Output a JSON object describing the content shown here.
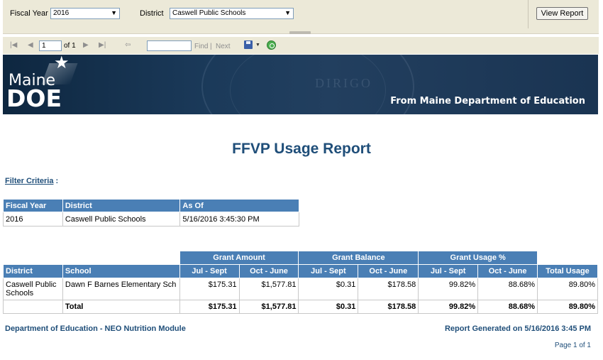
{
  "params": {
    "fiscal_year_label": "Fiscal Year",
    "fiscal_year_value": "2016",
    "district_label": "District",
    "district_value": "Caswell Public Schools",
    "view_report_label": "View Report"
  },
  "toolbar": {
    "page_value": "1",
    "of_pages": "of 1",
    "find_label": "Find",
    "separator": "|",
    "next_label": "Next"
  },
  "banner": {
    "logo_maine": "Maine",
    "logo_doe": "DOE",
    "seal_text": "DIRIGO",
    "tagline": "From Maine Department of Education"
  },
  "report": {
    "title": "FFVP Usage Report",
    "filter_criteria_label": "Filter Criteria",
    "filter_criteria_suffix": " :"
  },
  "filter_table": {
    "headers": [
      "Fiscal Year",
      "District",
      "As Of"
    ],
    "row": [
      "2016",
      "Caswell Public Schools",
      "5/16/2016 3:45:30 PM"
    ]
  },
  "usage_table": {
    "group_headers": [
      "Grant Amount",
      "Grant Balance",
      "Grant Usage %"
    ],
    "headers": [
      "District",
      "School",
      "Jul - Sept",
      "Oct - June",
      "Jul - Sept",
      "Oct - June",
      "Jul - Sept",
      "Oct - June",
      "Total Usage"
    ],
    "row": [
      "Caswell Public Schools",
      "Dawn F Barnes Elementary Sch",
      "$175.31",
      "$1,577.81",
      "$0.31",
      "$178.58",
      "99.82%",
      "88.68%",
      "89.80%"
    ],
    "total": [
      "",
      "Total",
      "$175.31",
      "$1,577.81",
      "$0.31",
      "$178.58",
      "99.82%",
      "88.68%",
      "89.80%"
    ]
  },
  "footer": {
    "left": "Department of Education - NEO Nutrition Module",
    "right": "Report Generated on 5/16/2016 3:45 PM",
    "page": "Page 1 of 1"
  }
}
